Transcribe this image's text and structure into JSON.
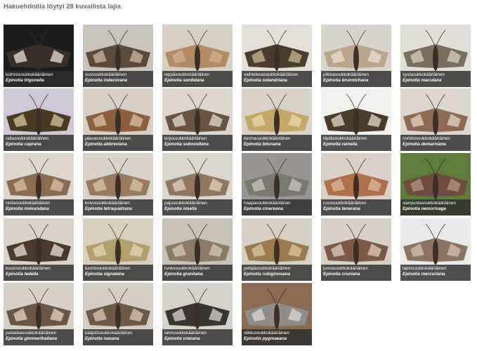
{
  "header": {
    "title": "Hakuehdoilla löytyi 28 kuvallista lajia"
  },
  "species": [
    {
      "fi": "kolmiosoukkokääriäinen",
      "la": "Epinotia trigonella",
      "bg": "#1c1c1c",
      "wing": "#3a2e28",
      "accent": "#e8e2d8"
    },
    {
      "fi": "suosoukkokääriäinen",
      "la": "Epinotia indecorana",
      "bg": "#c9c4bb",
      "wing": "#5c4b3a",
      "accent": "#c8b79a"
    },
    {
      "fi": "leppäsoukkokääriäinen",
      "la": "Epinotia sordidana",
      "bg": "#d8cfc4",
      "wing": "#b38a66",
      "accent": "#d2b08e"
    },
    {
      "fi": "vaihtelevasoukkokääriäinen",
      "la": "Epinotia solandriana",
      "bg": "#e4dfd7",
      "wing": "#4a3d2c",
      "accent": "#c9b68d"
    },
    {
      "fi": "pilkkasoukkokääriäinen",
      "la": "Epinotia brunnichana",
      "bg": "#d8d4cc",
      "wing": "#b9a68c",
      "accent": "#e8e0cf"
    },
    {
      "fi": "sysisoukkokääriäinen",
      "la": "Epinotia maculana",
      "bg": "#e2dfd8",
      "wing": "#7a6f5c",
      "accent": "#d9d2c0"
    },
    {
      "fi": "raitasoukkokääriäinen",
      "la": "Epinotia caprana",
      "bg": "#cfc6d6",
      "wing": "#4b3a22",
      "accent": "#d7c59a"
    },
    {
      "fi": "jalavasoukkokääriäinen",
      "la": "Epinotia abbreviana",
      "bg": "#d7cfc4",
      "wing": "#8c5f3e",
      "accent": "#d6c1a6"
    },
    {
      "fi": "kirjosoukkokääriäinen",
      "la": "Epinotia subocellana",
      "bg": "#ddd6cc",
      "wing": "#6a5440",
      "accent": "#e5dccd"
    },
    {
      "fi": "kermasoukkokääriäinen",
      "la": "Epinotia bilunana",
      "bg": "#d8d3c6",
      "wing": "#c3a867",
      "accent": "#e6d8ae"
    },
    {
      "fi": "täpläsoukkokääriäinen",
      "la": "Epinotia ramella",
      "bg": "#f1f1ee",
      "wing": "#4a3b2a",
      "accent": "#e6dcc4"
    },
    {
      "fi": "norkkosoukkokääriäinen",
      "la": "Epinotia demarniana",
      "bg": "#dcd6cd",
      "wing": "#8d6a54",
      "accent": "#e3d6c6"
    },
    {
      "fi": "rantasoukkokääriäinen",
      "la": "Epinotia immundana",
      "bg": "#ddd7ce",
      "wing": "#8a6c52",
      "accent": "#d6c2a8"
    },
    {
      "fi": "koivusoukkokääriäinen",
      "la": "Epinotia tetraquetrana",
      "bg": "#d9d3c9",
      "wing": "#9a7b60",
      "accent": "#d9c6ad"
    },
    {
      "fi": "pajusoukkokääriäinen",
      "la": "Epinotia nisella",
      "bg": "#dbd6ce",
      "wing": "#8f7760",
      "accent": "#e0d3c1"
    },
    {
      "fi": "haapasoukkokääriäinen",
      "la": "Epinotia cinereana",
      "bg": "#9a9590",
      "wing": "#7d7772",
      "accent": "#c9c4bd"
    },
    {
      "fi": "rusosoukkokääriäinen",
      "la": "Epinotia tenerana",
      "bg": "#d9d1c8",
      "wing": "#b0704a",
      "accent": "#d9b9a0"
    },
    {
      "fi": "sianpuolasoukkokääriäinen",
      "la": "Epinotia nemorivaga",
      "bg": "#5f7d3a",
      "wing": "#6e4c40",
      "accent": "#b99486"
    },
    {
      "fi": "kuusisoukkokääriäinen",
      "la": "Epinotia tedella",
      "bg": "#d8d2c8",
      "wing": "#4b3a2c",
      "accent": "#eae3d6"
    },
    {
      "fi": "tuomisoukkokääriäinen",
      "la": "Epinotia signatana",
      "bg": "#d8cfbf",
      "wing": "#b49e6e",
      "accent": "#e4d7b6"
    },
    {
      "fi": "runkosoukkokääriäinen",
      "la": "Epinotia granitana",
      "bg": "#c8c1b5",
      "wing": "#8a7a66",
      "accent": "#d4c9b6"
    },
    {
      "fi": "petäjäsoukkokääriäinen",
      "la": "Epinotia rubiginosana",
      "bg": "#d6cfc3",
      "wing": "#9a7b4e",
      "accent": "#d9c7a2"
    },
    {
      "fi": "juovasoukkokääriäinen",
      "la": "Epinotia cruciana",
      "bg": "#d7d0c7",
      "wing": "#7b5a46",
      "accent": "#e0cfc0"
    },
    {
      "fi": "lapinsoukkokääriäinen",
      "la": "Epinotia mercuriana",
      "bg": "#e9e9e9",
      "wing": "#8c7560",
      "accent": "#cfc3b4"
    },
    {
      "fi": "juolukkasoukkokääriäinen",
      "la": "Epinotia gimmerthaliana",
      "bg": "#d6d0c6",
      "wing": "#6b5644",
      "accent": "#e1d5c4"
    },
    {
      "fi": "kääpiösoukkokääriäinen",
      "la": "Epinotia nanana",
      "bg": "#d3cdc3",
      "wing": "#6e5a44",
      "accent": "#d8cbb3"
    },
    {
      "fi": "talvisoukkokääriäinen",
      "la": "Epinotia crenana",
      "bg": "#d6d1c9",
      "wing": "#3a3530",
      "accent": "#dcd6cc"
    },
    {
      "fi": "viikkusoukkokääriäinen",
      "la": "Epinotia pygmaeana",
      "bg": "#8a6a50",
      "wing": "#8f8c8a",
      "accent": "#d8d6d3"
    }
  ]
}
